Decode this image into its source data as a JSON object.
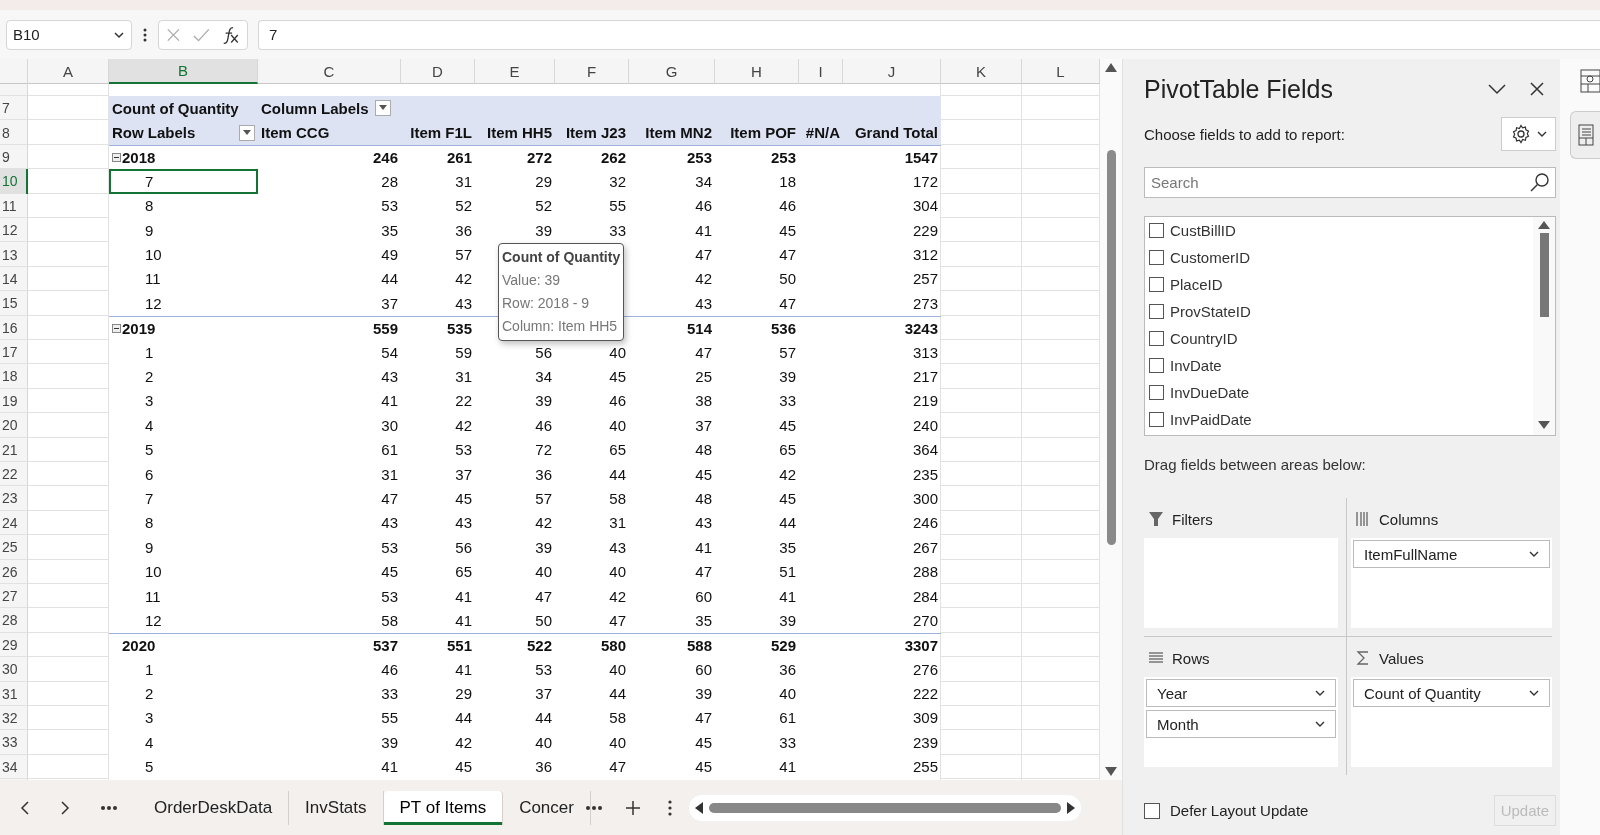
{
  "formula_bar": {
    "name_box": "B10",
    "formula": "7"
  },
  "sheet": {
    "columns": [
      {
        "label": "A",
        "selected": false
      },
      {
        "label": "B",
        "selected": true
      },
      {
        "label": "C",
        "selected": false
      },
      {
        "label": "D",
        "selected": false
      },
      {
        "label": "E",
        "selected": false
      },
      {
        "label": "F",
        "selected": false
      },
      {
        "label": "G",
        "selected": false
      },
      {
        "label": "H",
        "selected": false
      },
      {
        "label": "I",
        "selected": false
      },
      {
        "label": "J",
        "selected": false
      },
      {
        "label": "K",
        "selected": false
      },
      {
        "label": "L",
        "selected": false
      }
    ],
    "pivot": {
      "header_row": {
        "number": "7",
        "values_label": "Count of Quantity",
        "column_labels": "Column Labels"
      },
      "label_row": {
        "number": "8",
        "row_labels": "Row Labels",
        "items": [
          "Item CCG",
          "Item F1L",
          "Item HH5",
          "Item J23",
          "Item MN2",
          "Item POF",
          "#N/A",
          "Grand Total"
        ]
      },
      "rows": [
        {
          "number": "9",
          "kind": "year",
          "label": "2018",
          "collapse_button": true,
          "selected": false,
          "values": {
            "c": "246",
            "d": "261",
            "e": "272",
            "f": "262",
            "g": "253",
            "h": "253",
            "j": "1547"
          }
        },
        {
          "number": "10",
          "kind": "month",
          "label": "7",
          "selected": true,
          "values": {
            "c": "28",
            "d": "31",
            "e": "29",
            "f": "32",
            "g": "34",
            "h": "18",
            "j": "172"
          }
        },
        {
          "number": "11",
          "kind": "month",
          "label": "8",
          "selected": false,
          "values": {
            "c": "53",
            "d": "52",
            "e": "52",
            "f": "55",
            "g": "46",
            "h": "46",
            "j": "304"
          }
        },
        {
          "number": "12",
          "kind": "month",
          "label": "9",
          "selected": false,
          "values": {
            "c": "35",
            "d": "36",
            "e": "39",
            "f": "33",
            "g": "41",
            "h": "45",
            "j": "229"
          }
        },
        {
          "number": "13",
          "kind": "month",
          "label": "10",
          "selected": false,
          "values": {
            "c": "49",
            "d": "57",
            "g": "47",
            "h": "47",
            "j": "312"
          }
        },
        {
          "number": "14",
          "kind": "month",
          "label": "11",
          "selected": false,
          "values": {
            "c": "44",
            "d": "42",
            "g": "42",
            "h": "50",
            "j": "257"
          }
        },
        {
          "number": "15",
          "kind": "month",
          "label": "12",
          "selected": false,
          "values": {
            "c": "37",
            "d": "43",
            "g": "43",
            "h": "47",
            "j": "273"
          }
        },
        {
          "number": "16",
          "kind": "year",
          "label": "2019",
          "collapse_button": true,
          "selected": false,
          "values": {
            "c": "559",
            "d": "535",
            "g": "514",
            "h": "536",
            "j": "3243"
          }
        },
        {
          "number": "17",
          "kind": "month",
          "label": "1",
          "selected": false,
          "values": {
            "c": "54",
            "d": "59",
            "e": "56",
            "f": "40",
            "g": "47",
            "h": "57",
            "j": "313"
          }
        },
        {
          "number": "18",
          "kind": "month",
          "label": "2",
          "selected": false,
          "values": {
            "c": "43",
            "d": "31",
            "e": "34",
            "f": "45",
            "g": "25",
            "h": "39",
            "j": "217"
          }
        },
        {
          "number": "19",
          "kind": "month",
          "label": "3",
          "selected": false,
          "values": {
            "c": "41",
            "d": "22",
            "e": "39",
            "f": "46",
            "g": "38",
            "h": "33",
            "j": "219"
          }
        },
        {
          "number": "20",
          "kind": "month",
          "label": "4",
          "selected": false,
          "values": {
            "c": "30",
            "d": "42",
            "e": "46",
            "f": "40",
            "g": "37",
            "h": "45",
            "j": "240"
          }
        },
        {
          "number": "21",
          "kind": "month",
          "label": "5",
          "selected": false,
          "values": {
            "c": "61",
            "d": "53",
            "e": "72",
            "f": "65",
            "g": "48",
            "h": "65",
            "j": "364"
          }
        },
        {
          "number": "22",
          "kind": "month",
          "label": "6",
          "selected": false,
          "values": {
            "c": "31",
            "d": "37",
            "e": "36",
            "f": "44",
            "g": "45",
            "h": "42",
            "j": "235"
          }
        },
        {
          "number": "23",
          "kind": "month",
          "label": "7",
          "selected": false,
          "values": {
            "c": "47",
            "d": "45",
            "e": "57",
            "f": "58",
            "g": "48",
            "h": "45",
            "j": "300"
          }
        },
        {
          "number": "24",
          "kind": "month",
          "label": "8",
          "selected": false,
          "values": {
            "c": "43",
            "d": "43",
            "e": "42",
            "f": "31",
            "g": "43",
            "h": "44",
            "j": "246"
          }
        },
        {
          "number": "25",
          "kind": "month",
          "label": "9",
          "selected": false,
          "values": {
            "c": "53",
            "d": "56",
            "e": "39",
            "f": "43",
            "g": "41",
            "h": "35",
            "j": "267"
          }
        },
        {
          "number": "26",
          "kind": "month",
          "label": "10",
          "selected": false,
          "values": {
            "c": "45",
            "d": "65",
            "e": "40",
            "f": "40",
            "g": "47",
            "h": "51",
            "j": "288"
          }
        },
        {
          "number": "27",
          "kind": "month",
          "label": "11",
          "selected": false,
          "values": {
            "c": "53",
            "d": "41",
            "e": "47",
            "f": "42",
            "g": "60",
            "h": "41",
            "j": "284"
          }
        },
        {
          "number": "28",
          "kind": "month",
          "label": "12",
          "selected": false,
          "values": {
            "c": "58",
            "d": "41",
            "e": "50",
            "f": "47",
            "g": "35",
            "h": "39",
            "j": "270"
          }
        },
        {
          "number": "29",
          "kind": "year",
          "label": "2020",
          "collapse_button": false,
          "selected": false,
          "values": {
            "c": "537",
            "d": "551",
            "e": "522",
            "f": "580",
            "g": "588",
            "h": "529",
            "j": "3307"
          }
        },
        {
          "number": "30",
          "kind": "month",
          "label": "1",
          "selected": false,
          "values": {
            "c": "46",
            "d": "41",
            "e": "53",
            "f": "40",
            "g": "60",
            "h": "36",
            "j": "276"
          }
        },
        {
          "number": "31",
          "kind": "month",
          "label": "2",
          "selected": false,
          "values": {
            "c": "33",
            "d": "29",
            "e": "37",
            "f": "44",
            "g": "39",
            "h": "40",
            "j": "222"
          }
        },
        {
          "number": "32",
          "kind": "month",
          "label": "3",
          "selected": false,
          "values": {
            "c": "55",
            "d": "44",
            "e": "44",
            "f": "58",
            "g": "47",
            "h": "61",
            "j": "309"
          }
        },
        {
          "number": "33",
          "kind": "month",
          "label": "4",
          "selected": false,
          "values": {
            "c": "39",
            "d": "42",
            "e": "40",
            "f": "40",
            "g": "45",
            "h": "33",
            "j": "239"
          }
        },
        {
          "number": "34",
          "kind": "month",
          "label": "5",
          "selected": false,
          "values": {
            "c": "41",
            "d": "45",
            "e": "36",
            "f": "47",
            "g": "45",
            "h": "41",
            "j": "255"
          }
        }
      ]
    },
    "tooltip": {
      "title": "Count of Quantity",
      "lines": [
        "Value: 39",
        "Row: 2018 - 9",
        "Column: Item HH5"
      ]
    }
  },
  "sheet_tabs": [
    {
      "label": "OrderDeskData",
      "selected": false
    },
    {
      "label": "InvStats",
      "selected": false
    },
    {
      "label": "PT of Items",
      "selected": true
    },
    {
      "label": "Concer",
      "selected": false
    }
  ],
  "pivot_panel": {
    "title": "PivotTable Fields",
    "subtitle": "Choose fields to add to report:",
    "search": {
      "placeholder": "Search"
    },
    "fields": [
      {
        "label": "CustBillID",
        "checked": false
      },
      {
        "label": "CustomerID",
        "checked": false
      },
      {
        "label": "PlaceID",
        "checked": false
      },
      {
        "label": "ProvStateID",
        "checked": false
      },
      {
        "label": "CountryID",
        "checked": false
      },
      {
        "label": "InvDate",
        "checked": false
      },
      {
        "label": "InvDueDate",
        "checked": false
      },
      {
        "label": "InvPaidDate",
        "checked": false
      }
    ],
    "areas_hint": "Drag fields between areas below:",
    "areas": [
      {
        "kind": "filters",
        "label": "Filters"
      },
      {
        "kind": "columns",
        "label": "Columns",
        "fields": [
          "ItemFullName"
        ]
      },
      {
        "kind": "rows",
        "label": "Rows",
        "fields": [
          "Year",
          "Month"
        ]
      },
      {
        "kind": "values",
        "label": "Values",
        "fields": [
          "Count of Quantity"
        ]
      }
    ],
    "defer": {
      "label": "Defer Layout Update",
      "checked": false
    },
    "update_button": {
      "label": "Update",
      "disabled": true
    }
  }
}
